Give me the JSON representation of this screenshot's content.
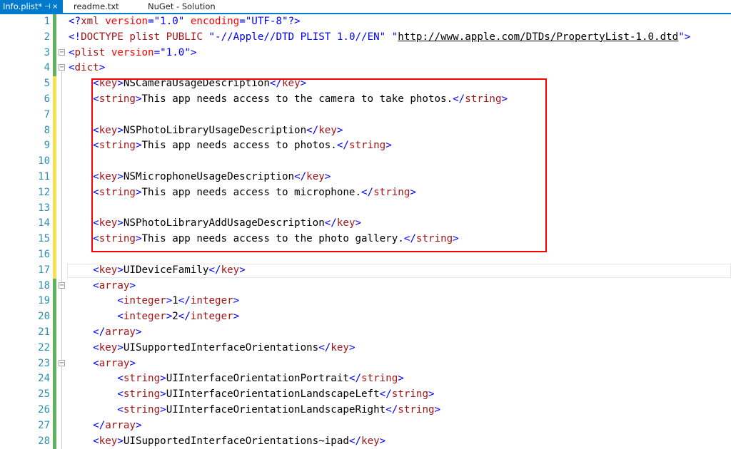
{
  "tabs": [
    {
      "label": "Info.plist*",
      "active": true,
      "icons": [
        "pin",
        "close"
      ]
    },
    {
      "label": "readme.txt",
      "active": false
    },
    {
      "label": "NuGet - Solution",
      "active": false
    }
  ],
  "colors": {
    "accent": "#007acc",
    "line_number": "#2b91af",
    "punct": "#0000ff",
    "element": "#a31515",
    "attr": "#ff0000",
    "highlight": "#ff0000",
    "saved_change": "#5fb35f",
    "unsaved_change": "#f5e24e"
  },
  "editor": {
    "lines": [
      {
        "num": "1",
        "tokens": [
          [
            "pu",
            "<?"
          ],
          [
            "el",
            "xml"
          ],
          [
            "tx",
            " "
          ],
          [
            "at",
            "version"
          ],
          [
            "pu",
            "="
          ],
          [
            "av",
            "\"1.0\""
          ],
          [
            "tx",
            " "
          ],
          [
            "at",
            "encoding"
          ],
          [
            "pu",
            "="
          ],
          [
            "av",
            "\"UTF-8\""
          ],
          [
            "pu",
            "?>"
          ]
        ]
      },
      {
        "num": "2",
        "tokens": [
          [
            "pu",
            "<!"
          ],
          [
            "el",
            "DOCTYPE plist PUBLIC"
          ],
          [
            "tx",
            " "
          ],
          [
            "av",
            "\"-//Apple//DTD PLIST 1.0//EN\""
          ],
          [
            "tx",
            " "
          ],
          [
            "av",
            "\""
          ],
          [
            "ul",
            "http://www.apple.com/DTDs/PropertyList-1.0.dtd"
          ],
          [
            "av",
            "\""
          ],
          [
            "pu",
            ">"
          ]
        ]
      },
      {
        "num": "3",
        "tokens": [
          [
            "pu",
            "<"
          ],
          [
            "el",
            "plist"
          ],
          [
            "tx",
            " "
          ],
          [
            "at",
            "version"
          ],
          [
            "pu",
            "="
          ],
          [
            "av",
            "\"1.0\""
          ],
          [
            "pu",
            ">"
          ]
        ]
      },
      {
        "num": "4",
        "tokens": [
          [
            "pu",
            "<"
          ],
          [
            "el",
            "dict"
          ],
          [
            "pu",
            ">"
          ]
        ]
      },
      {
        "num": "5",
        "tokens": [
          [
            "tx",
            "    "
          ],
          [
            "pu",
            "<"
          ],
          [
            "el",
            "key"
          ],
          [
            "pu",
            ">"
          ],
          [
            "tx",
            "NSCameraUsageDescription"
          ],
          [
            "pu",
            "</"
          ],
          [
            "el",
            "key"
          ],
          [
            "pu",
            ">"
          ]
        ]
      },
      {
        "num": "6",
        "tokens": [
          [
            "tx",
            "    "
          ],
          [
            "pu",
            "<"
          ],
          [
            "el",
            "string"
          ],
          [
            "pu",
            ">"
          ],
          [
            "tx",
            "This app needs access to the camera to take photos."
          ],
          [
            "pu",
            "</"
          ],
          [
            "el",
            "string"
          ],
          [
            "pu",
            ">"
          ]
        ]
      },
      {
        "num": "7",
        "tokens": []
      },
      {
        "num": "8",
        "tokens": [
          [
            "tx",
            "    "
          ],
          [
            "pu",
            "<"
          ],
          [
            "el",
            "key"
          ],
          [
            "pu",
            ">"
          ],
          [
            "tx",
            "NSPhotoLibraryUsageDescription"
          ],
          [
            "pu",
            "</"
          ],
          [
            "el",
            "key"
          ],
          [
            "pu",
            ">"
          ]
        ]
      },
      {
        "num": "9",
        "tokens": [
          [
            "tx",
            "    "
          ],
          [
            "pu",
            "<"
          ],
          [
            "el",
            "string"
          ],
          [
            "pu",
            ">"
          ],
          [
            "tx",
            "This app needs access to photos."
          ],
          [
            "pu",
            "</"
          ],
          [
            "el",
            "string"
          ],
          [
            "pu",
            ">"
          ]
        ]
      },
      {
        "num": "10",
        "tokens": []
      },
      {
        "num": "11",
        "tokens": [
          [
            "tx",
            "    "
          ],
          [
            "pu",
            "<"
          ],
          [
            "el",
            "key"
          ],
          [
            "pu",
            ">"
          ],
          [
            "tx",
            "NSMicrophoneUsageDescription"
          ],
          [
            "pu",
            "</"
          ],
          [
            "el",
            "key"
          ],
          [
            "pu",
            ">"
          ]
        ]
      },
      {
        "num": "12",
        "tokens": [
          [
            "tx",
            "    "
          ],
          [
            "pu",
            "<"
          ],
          [
            "el",
            "string"
          ],
          [
            "pu",
            ">"
          ],
          [
            "tx",
            "This app needs access to microphone."
          ],
          [
            "pu",
            "</"
          ],
          [
            "el",
            "string"
          ],
          [
            "pu",
            ">"
          ]
        ]
      },
      {
        "num": "13",
        "tokens": []
      },
      {
        "num": "14",
        "tokens": [
          [
            "tx",
            "    "
          ],
          [
            "pu",
            "<"
          ],
          [
            "el",
            "key"
          ],
          [
            "pu",
            ">"
          ],
          [
            "tx",
            "NSPhotoLibraryAddUsageDescription"
          ],
          [
            "pu",
            "</"
          ],
          [
            "el",
            "key"
          ],
          [
            "pu",
            ">"
          ]
        ]
      },
      {
        "num": "15",
        "tokens": [
          [
            "tx",
            "    "
          ],
          [
            "pu",
            "<"
          ],
          [
            "el",
            "string"
          ],
          [
            "pu",
            ">"
          ],
          [
            "tx",
            "This app needs access to the photo gallery."
          ],
          [
            "pu",
            "</"
          ],
          [
            "el",
            "string"
          ],
          [
            "pu",
            ">"
          ]
        ]
      },
      {
        "num": "16",
        "tokens": []
      },
      {
        "num": "17",
        "tokens": [
          [
            "tx",
            "    "
          ],
          [
            "pu",
            "<"
          ],
          [
            "el",
            "key"
          ],
          [
            "pu",
            ">"
          ],
          [
            "tx",
            "UIDeviceFamily"
          ],
          [
            "pu",
            "</"
          ],
          [
            "el",
            "key"
          ],
          [
            "pu",
            ">"
          ]
        ]
      },
      {
        "num": "18",
        "tokens": [
          [
            "tx",
            "    "
          ],
          [
            "pu",
            "<"
          ],
          [
            "el",
            "array"
          ],
          [
            "pu",
            ">"
          ]
        ]
      },
      {
        "num": "19",
        "tokens": [
          [
            "tx",
            "        "
          ],
          [
            "pu",
            "<"
          ],
          [
            "el",
            "integer"
          ],
          [
            "pu",
            ">"
          ],
          [
            "tx",
            "1"
          ],
          [
            "pu",
            "</"
          ],
          [
            "el",
            "integer"
          ],
          [
            "pu",
            ">"
          ]
        ]
      },
      {
        "num": "20",
        "tokens": [
          [
            "tx",
            "        "
          ],
          [
            "pu",
            "<"
          ],
          [
            "el",
            "integer"
          ],
          [
            "pu",
            ">"
          ],
          [
            "tx",
            "2"
          ],
          [
            "pu",
            "</"
          ],
          [
            "el",
            "integer"
          ],
          [
            "pu",
            ">"
          ]
        ]
      },
      {
        "num": "21",
        "tokens": [
          [
            "tx",
            "    "
          ],
          [
            "pu",
            "</"
          ],
          [
            "el",
            "array"
          ],
          [
            "pu",
            ">"
          ]
        ]
      },
      {
        "num": "22",
        "tokens": [
          [
            "tx",
            "    "
          ],
          [
            "pu",
            "<"
          ],
          [
            "el",
            "key"
          ],
          [
            "pu",
            ">"
          ],
          [
            "tx",
            "UISupportedInterfaceOrientations"
          ],
          [
            "pu",
            "</"
          ],
          [
            "el",
            "key"
          ],
          [
            "pu",
            ">"
          ]
        ]
      },
      {
        "num": "23",
        "tokens": [
          [
            "tx",
            "    "
          ],
          [
            "pu",
            "<"
          ],
          [
            "el",
            "array"
          ],
          [
            "pu",
            ">"
          ]
        ]
      },
      {
        "num": "24",
        "tokens": [
          [
            "tx",
            "        "
          ],
          [
            "pu",
            "<"
          ],
          [
            "el",
            "string"
          ],
          [
            "pu",
            ">"
          ],
          [
            "tx",
            "UIInterfaceOrientationPortrait"
          ],
          [
            "pu",
            "</"
          ],
          [
            "el",
            "string"
          ],
          [
            "pu",
            ">"
          ]
        ]
      },
      {
        "num": "25",
        "tokens": [
          [
            "tx",
            "        "
          ],
          [
            "pu",
            "<"
          ],
          [
            "el",
            "string"
          ],
          [
            "pu",
            ">"
          ],
          [
            "tx",
            "UIInterfaceOrientationLandscapeLeft"
          ],
          [
            "pu",
            "</"
          ],
          [
            "el",
            "string"
          ],
          [
            "pu",
            ">"
          ]
        ]
      },
      {
        "num": "26",
        "tokens": [
          [
            "tx",
            "        "
          ],
          [
            "pu",
            "<"
          ],
          [
            "el",
            "string"
          ],
          [
            "pu",
            ">"
          ],
          [
            "tx",
            "UIInterfaceOrientationLandscapeRight"
          ],
          [
            "pu",
            "</"
          ],
          [
            "el",
            "string"
          ],
          [
            "pu",
            ">"
          ]
        ]
      },
      {
        "num": "27",
        "tokens": [
          [
            "tx",
            "    "
          ],
          [
            "pu",
            "</"
          ],
          [
            "el",
            "array"
          ],
          [
            "pu",
            ">"
          ]
        ]
      },
      {
        "num": "28",
        "tokens": [
          [
            "tx",
            "    "
          ],
          [
            "pu",
            "<"
          ],
          [
            "el",
            "key"
          ],
          [
            "pu",
            ">"
          ],
          [
            "tx",
            "UISupportedInterfaceOrientations~ipad"
          ],
          [
            "pu",
            "</"
          ],
          [
            "el",
            "key"
          ],
          [
            "pu",
            ">"
          ]
        ]
      }
    ]
  }
}
